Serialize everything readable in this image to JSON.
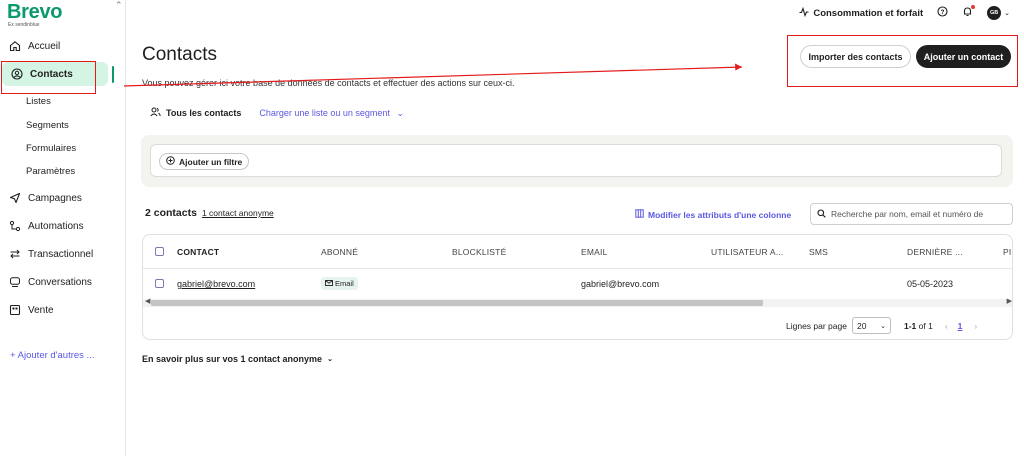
{
  "app": {
    "logo": "Brevo",
    "logo_sub": "Ex sendinblue"
  },
  "sidebar": {
    "items": [
      {
        "label": "Accueil",
        "icon": "home-icon"
      },
      {
        "label": "Contacts",
        "icon": "contacts-icon",
        "active": true
      },
      {
        "label": "Campagnes",
        "icon": "send-icon"
      },
      {
        "label": "Automations",
        "icon": "automation-icon"
      },
      {
        "label": "Transactionnel",
        "icon": "transfer-icon"
      },
      {
        "label": "Conversations",
        "icon": "chat-icon"
      },
      {
        "label": "Vente",
        "icon": "sales-icon"
      }
    ],
    "subitems": [
      "Listes",
      "Segments",
      "Formulaires",
      "Paramètres"
    ],
    "add_more": "+ Ajouter d'autres ..."
  },
  "topbar": {
    "consumption": "Consommation et forfait",
    "avatar_initials": "GB"
  },
  "main": {
    "title": "Contacts",
    "description": "Vous pouvez gérer ici votre base de données de contacts et effectuer des actions sur ceux-ci.",
    "import_button": "Importer des contacts",
    "add_button": "Ajouter un contact",
    "tab_all": "Tous les contacts",
    "tab_load": "Charger une liste ou un segment",
    "add_filter": "Ajouter un filtre",
    "contacts_count": "2 contacts",
    "anonymous_link": "1 contact anonyme",
    "edit_attributes": "Modifier les attributs d'une colonne",
    "search_placeholder": "Recherche par nom, email et numéro de",
    "learn_more": "En savoir plus sur vos 1 contact anonyme"
  },
  "table": {
    "headers": [
      "CONTACT",
      "ABONNÉ",
      "BLOCKLISTÉ",
      "EMAIL",
      "UTILISATEUR A...",
      "SMS",
      "DERNIÈRE ...",
      "PI"
    ],
    "rows": [
      {
        "contact": "gabriel@brevo.com",
        "abonne": "Email",
        "blocklist": "",
        "email": "gabriel@brevo.com",
        "utilisateur": "",
        "sms": "",
        "derniere": "05-05-2023"
      }
    ]
  },
  "pagination": {
    "rows_per_page_label": "Lignes par page",
    "rows_per_page": "20",
    "range_bold": "1-1",
    "range_rest": " of 1",
    "current_page": "1"
  },
  "colors": {
    "brand_green": "#0b996e",
    "active_bg": "#d4f5e4",
    "link_purple": "#5b58e2",
    "annotation_red": "#e41b1b"
  }
}
